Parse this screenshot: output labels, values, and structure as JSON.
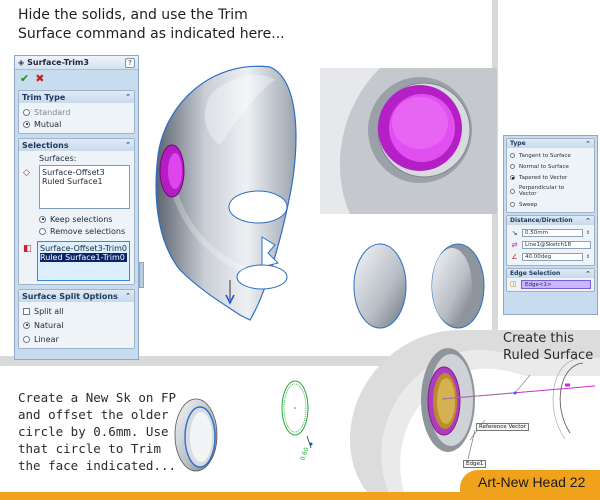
{
  "captions": {
    "top": "Hide the solids, and use the Trim Surface command as indicated here...",
    "ruled": "Create this Ruled Surface",
    "bottom": "Create a New Sk on FP and offset the older circle by 0.6mm. Use that circle to Trim the face indicated..."
  },
  "property_manager": {
    "title": "Surface-Trim3",
    "help": "?",
    "trim_type": {
      "header": "Trim Type",
      "options": [
        "Standard",
        "Mutual"
      ],
      "selected": "Mutual"
    },
    "selections": {
      "header": "Selections",
      "surfaces_label": "Surfaces:",
      "surfaces": [
        "Surface-Offset3",
        "Ruled Surface1"
      ],
      "keep_label": "Keep selections",
      "remove_label": "Remove selections",
      "selected_mode": "Keep selections",
      "pieces": [
        "Surface-Offset3-Trim0",
        "Ruled Surface1-Trim0"
      ]
    },
    "split_options": {
      "header": "Surface Split Options",
      "split_all": "Split all",
      "natural": "Natural",
      "linear": "Linear",
      "selected": "Natural"
    }
  },
  "ruled_panel": {
    "type_header": "Type",
    "types": [
      "Tangent to Surface",
      "Normal to Surface",
      "Tapered to Vector",
      "Perpendicular to Vector",
      "Sweep"
    ],
    "selected_type": "Tapered to Vector",
    "distance_header": "Distance/Direction",
    "distance": "0.50mm",
    "line_ref": "Line1@Sketch18",
    "angle": "40.00deg",
    "edge_header": "Edge Selection",
    "edge": "Edge<1>"
  },
  "tags": {
    "reference_vector": "Reference Vector",
    "edge": "Edge1"
  },
  "banner": {
    "label": "Art-New Head 22"
  },
  "colors": {
    "accent": "#f0a21c",
    "magenta": "#c21bd1",
    "panel": "#c7dcef"
  }
}
